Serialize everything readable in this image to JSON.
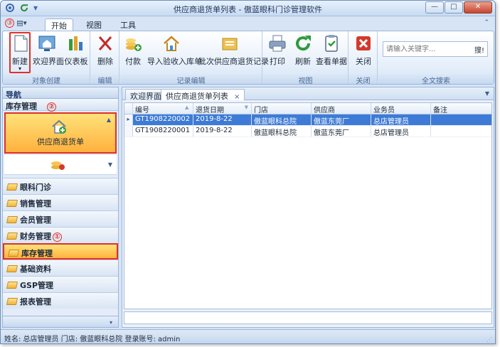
{
  "window": {
    "title": "供应商退货单列表 - 傲蓝眼科门诊管理软件",
    "controls": [
      "—",
      "□",
      "✕"
    ]
  },
  "quick_access": {
    "menu_glyph": "▾"
  },
  "ribbon": {
    "callout_number": "③",
    "tabs": [
      "开始",
      "视图",
      "工具"
    ],
    "groups": {
      "object_create": {
        "label": "对象创建",
        "buttons": [
          "新建",
          "欢迎界面",
          "仪表板"
        ]
      },
      "edit": {
        "label": "编辑",
        "buttons": [
          "删除"
        ]
      },
      "record_edit": {
        "label": "记录编辑",
        "buttons": [
          "付款",
          "导入验收入库单",
          "批次供应商退货记录"
        ]
      },
      "view": {
        "label": "视图",
        "buttons": [
          "打印",
          "刷新",
          "查看单据"
        ]
      },
      "close": {
        "label": "关闭",
        "buttons": [
          "关闭"
        ]
      },
      "search": {
        "label": "全文搜索",
        "placeholder": "请输入关键字...",
        "button": "搜!"
      }
    }
  },
  "nav": {
    "header": "导航",
    "section": "库存管理",
    "section_callout": "②",
    "featured_item": "供应商退货单",
    "items": [
      "眼科门诊",
      "销售管理",
      "会员管理",
      "财务管理",
      "库存管理",
      "基础资料",
      "GSP管理",
      "报表管理"
    ],
    "active_item": "库存管理",
    "finance_callout": "①"
  },
  "documents": {
    "tabs": [
      {
        "label": "欢迎界面",
        "active": false
      },
      {
        "label": "供应商退货单列表",
        "active": true,
        "close": "×"
      }
    ]
  },
  "grid": {
    "columns": [
      "编号",
      "退货日期",
      "门店",
      "供应商",
      "业务员",
      "备注"
    ],
    "rows": [
      {
        "code": "GT1908220002",
        "date": "2019-8-22",
        "store": "傲蓝眼科总院",
        "supplier": "傲蓝东莞厂",
        "staff": "总店管理员",
        "note": "",
        "selected": true
      },
      {
        "code": "GT1908220001",
        "date": "2019-8-22",
        "store": "傲蓝眼科总院",
        "supplier": "傲蓝东莞厂",
        "staff": "总店管理员",
        "note": "",
        "selected": false
      }
    ]
  },
  "status": {
    "text": "姓名: 总店管理员  门店: 傲蓝眼科总院  登录账号: admin"
  },
  "colors": {
    "selection": "#3d7bd6",
    "highlight": "#ffb13d",
    "callout_red": "#e0302a",
    "ribbon_blue": "#d6e4f5"
  }
}
